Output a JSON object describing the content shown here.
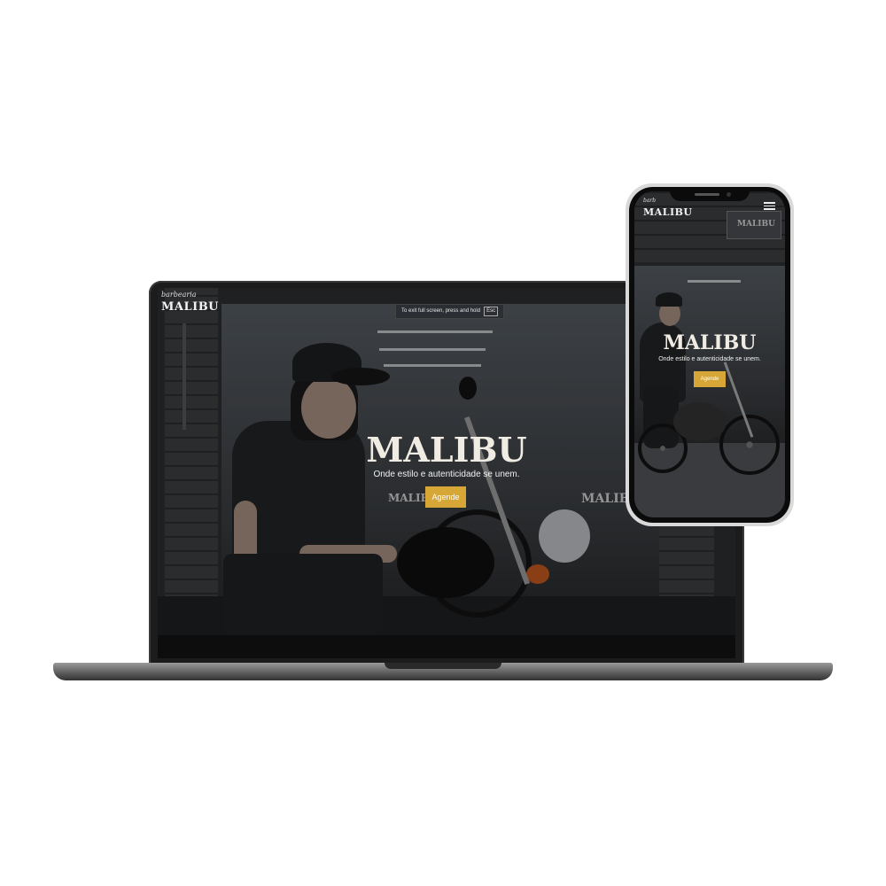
{
  "brand": {
    "logo_small": "barbearia",
    "logo_big": "MALIBU"
  },
  "laptop": {
    "fullscreen_hint": "To exit full screen, press and hold",
    "fullscreen_key": "Esc",
    "hero_title": "MALIBU",
    "hero_subtitle": "Onde estilo e autenticidade se unem.",
    "cta_label": "Agende",
    "sign_text": "MALIBU"
  },
  "phone": {
    "logo_small": "barb",
    "logo_big": "MALIBU",
    "hero_title": "MALIBU",
    "hero_subtitle": "Onde estilo e autenticidade se unem.",
    "cta_label": "Agende",
    "menu_icon": "hamburger-icon"
  },
  "colors": {
    "accent": "#d6a637",
    "device_dark": "#1c1c1c",
    "background": "#ffffff"
  }
}
